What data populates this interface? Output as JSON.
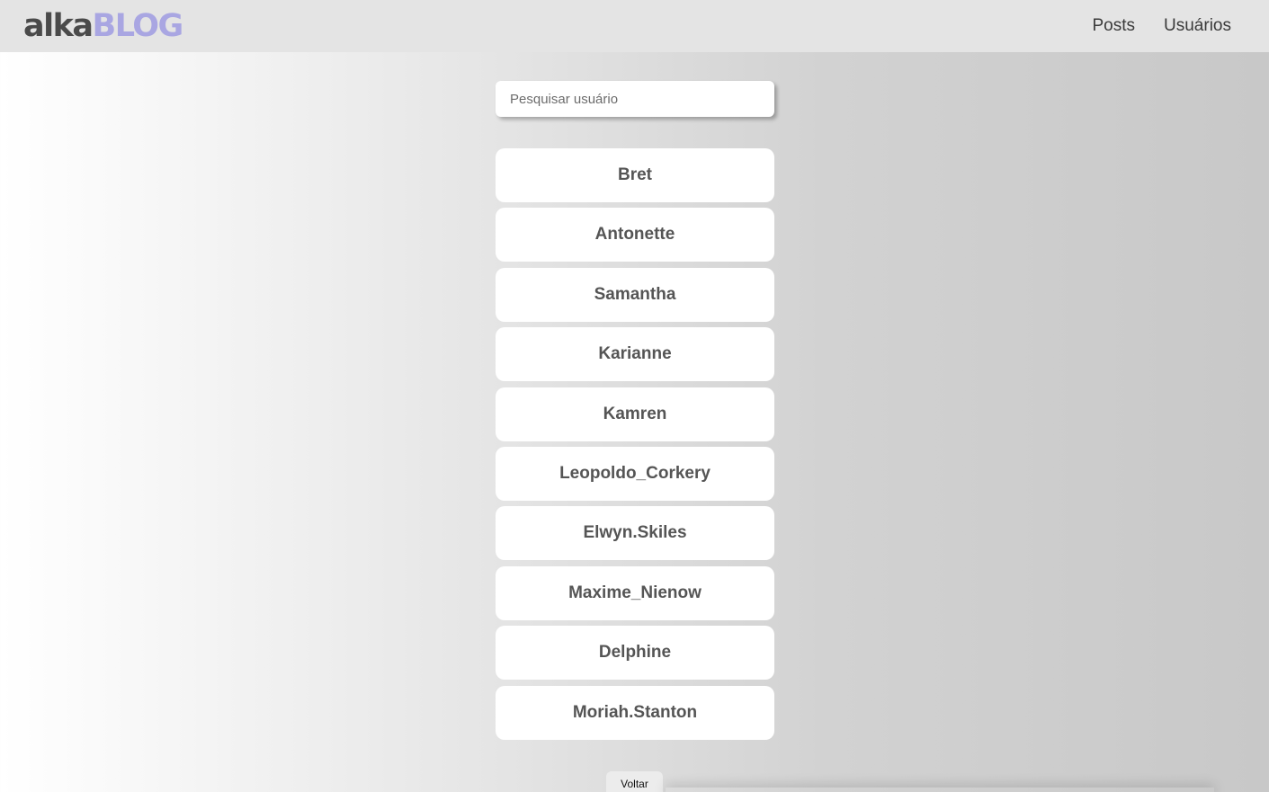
{
  "brand": {
    "part1": "alka",
    "part2": "BLOG"
  },
  "nav": {
    "posts": "Posts",
    "users": "Usuários"
  },
  "search": {
    "placeholder": "Pesquisar usuário",
    "value": ""
  },
  "users": [
    "Bret",
    "Antonette",
    "Samantha",
    "Karianne",
    "Kamren",
    "Leopoldo_Corkery",
    "Elwyn.Skiles",
    "Maxime_Nienow",
    "Delphine",
    "Moriah.Stanton"
  ],
  "back_label": "Voltar"
}
